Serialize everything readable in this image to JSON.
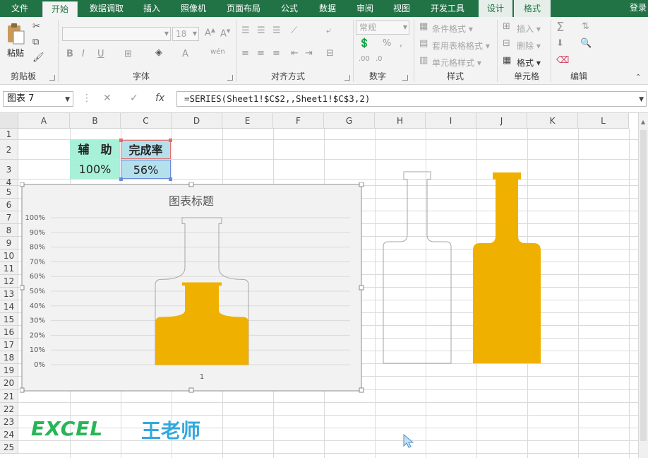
{
  "tabs": {
    "file": "文件",
    "home": "开始",
    "data_tune": "数据调取",
    "insert": "插入",
    "camera": "照像机",
    "layout": "页面布局",
    "formula": "公式",
    "data": "数据",
    "review": "审阅",
    "view": "视图",
    "dev": "开发工具",
    "design": "设计",
    "format": "格式"
  },
  "login": "登录",
  "ribbon": {
    "clipboard": {
      "paste": "粘贴",
      "label": "剪贴板"
    },
    "font": {
      "size": "18",
      "label": "字体"
    },
    "align": {
      "label": "对齐方式"
    },
    "number": {
      "format": "常规",
      "label": "数字"
    },
    "styles": {
      "cond": "条件格式",
      "table": "套用表格格式",
      "cell": "单元格样式",
      "label": "样式"
    },
    "cells": {
      "insert": "插入",
      "delete": "删除",
      "format": "格式",
      "label": "单元格"
    },
    "edit": {
      "label": "编辑"
    }
  },
  "formula_bar": {
    "name_box": "图表 7",
    "cancel": "✕",
    "enter": "✓",
    "fx": "fx",
    "formula": "=SERIES(Sheet1!$C$2,,Sheet1!$C$3,2)"
  },
  "columns": [
    "A",
    "B",
    "C",
    "D",
    "E",
    "F",
    "G",
    "H",
    "I",
    "J",
    "K",
    "L"
  ],
  "rows": [
    "1",
    "2",
    "3",
    "4",
    "5",
    "6",
    "7",
    "8",
    "9",
    "10",
    "11",
    "12",
    "13",
    "14",
    "15",
    "16",
    "17",
    "18",
    "19",
    "20",
    "21",
    "22",
    "23",
    "24",
    "25"
  ],
  "cells": {
    "b2": "辅　助",
    "c2": "完成率",
    "b3": "100%",
    "c3": "56%"
  },
  "colors": {
    "bottle_fill": "#f0b000",
    "header_green": "#a8f0d8",
    "selected_cell": "#b4e0ec",
    "brand": "#217346"
  },
  "chart_data": {
    "type": "bar",
    "title": "图表标题",
    "categories": [
      "1"
    ],
    "series": [
      {
        "name": "辅　助",
        "values": [
          1.0
        ]
      },
      {
        "name": "完成率",
        "values": [
          0.56
        ]
      }
    ],
    "ylim": [
      0,
      1
    ],
    "yticks": [
      "0%",
      "10%",
      "20%",
      "30%",
      "40%",
      "50%",
      "60%",
      "70%",
      "80%",
      "90%",
      "100%"
    ],
    "grid": true
  },
  "watermark": {
    "excel": "EXCEL",
    "teacher": "王老师"
  }
}
